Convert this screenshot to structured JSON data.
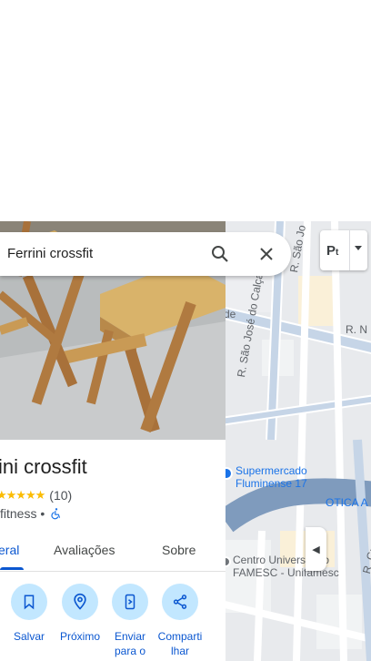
{
  "search": {
    "query": "Ferrini crossfit",
    "search_icon": "search-icon",
    "clear_icon": "close-icon"
  },
  "place": {
    "title": "ini crossfit",
    "rating": "★★★★★",
    "review_count": "(10)",
    "category": "fitness •",
    "accessibility_icon": "wheelchair-icon"
  },
  "tabs": [
    {
      "label": "eral",
      "active": true
    },
    {
      "label": "Avaliações",
      "active": false
    },
    {
      "label": "Sobre",
      "active": false
    }
  ],
  "actions": [
    {
      "label": "Salvar",
      "icon": "bookmark-icon"
    },
    {
      "label": "Próximo",
      "icon": "nearby-icon"
    },
    {
      "label": "Enviar para o",
      "icon": "send-to-phone-icon"
    },
    {
      "label": "Compartilhar",
      "label_line1": "Comparti",
      "label_line2": "lhar",
      "icon": "share-icon"
    }
  ],
  "map": {
    "layer_button": "P",
    "layer_button_sub": "t",
    "streets": {
      "sao_jose_calcado": "R. São José do Calçado",
      "sao_jo": "R. São Jo",
      "r_n": "R. N",
      "de": "de",
      "r_gua": "R. Gua"
    },
    "poi_supermercado": {
      "line1": "Supermercado",
      "line2": "Fluminense 17"
    },
    "poi_otica": "OTICA A",
    "poi_centro": {
      "line1": "Centro Universitário",
      "line2": "FAMESC - Unifamesc"
    },
    "collapse_icon": "chevron-left-icon"
  },
  "colors": {
    "accent": "#0b57d0",
    "action_bg": "#c2e7ff",
    "star": "#fbbc04",
    "map_bg": "#e8eaed",
    "road": "#c6d5e7"
  }
}
